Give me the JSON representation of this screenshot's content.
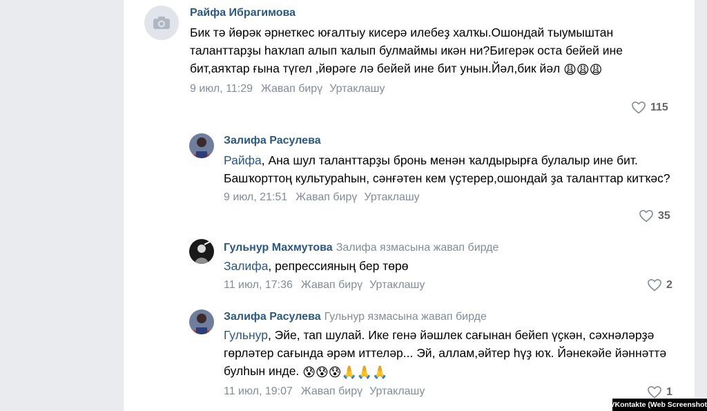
{
  "comments": [
    {
      "name": "Райфа Ибрагимова",
      "reply_to": "",
      "mention": "",
      "text": "Бик тә йөрәк әрнеткес юғалтыу кисерә илебеҙ халҡы.Ошондай тыумыштан таланттарҙы һаҡлап алып ҡалып булмаймы икән ни?Бигерәк оста бейей ине бит,аяҡтар ғына түгел ,йөрәге лә бейей ине бит унын.Йәл,бик йәл",
      "emoji": "😩😩😩",
      "date": "9 июл, 11:29",
      "reply_label": "Жавап бирү",
      "share_label": "Уртаклашу",
      "likes": "115"
    },
    {
      "name": "Залифа Расулева",
      "reply_to": "",
      "mention": "Райфа",
      "text": ", Ана шул таланттарҙы бронь менән ҡалдырырға булалыр ине бит. Башҡорттоң культураһын, сәнғәтен кем үҫтерер,ошондай ҙа таланттар китҡәс?",
      "emoji": "",
      "date": "9 июл, 21:51",
      "reply_label": "Жавап бирү",
      "share_label": "Уртаклашу",
      "likes": "35"
    },
    {
      "name": "Гульнур Махмутова",
      "reply_to": "Залифа язмасына жавап бирде",
      "mention": "Залифа",
      "text": ", репрессияның бер төрө",
      "emoji": "",
      "date": "11 июл, 17:36",
      "reply_label": "Жавап бирү",
      "share_label": "Уртаклашу",
      "likes": "2"
    },
    {
      "name": "Залифа Расулева",
      "reply_to": "Гульнур язмасына жавап бирде",
      "mention": "Гульнур",
      "text": ", Эйе, тап шулай. Ике генә йәшлек сағынан бейеп үҫкән, сәхнәләрҙә гөрләтер сағында әрәм иттеләр... Эй, аллам,әйтер һүҙ юҡ. Йәнекәйе йәннәттә булһын инде.",
      "emoji": "😰😰😰🙏🙏🙏",
      "date": "11 июл, 19:07",
      "reply_label": "Жавап бирү",
      "share_label": "Уртаклашу",
      "likes": "1"
    }
  ],
  "source_tag": "VKontakte (Web Screenshot)",
  "colors": {
    "link": "#2a5885",
    "meta": "#818c99",
    "background": "#e9ebee"
  }
}
